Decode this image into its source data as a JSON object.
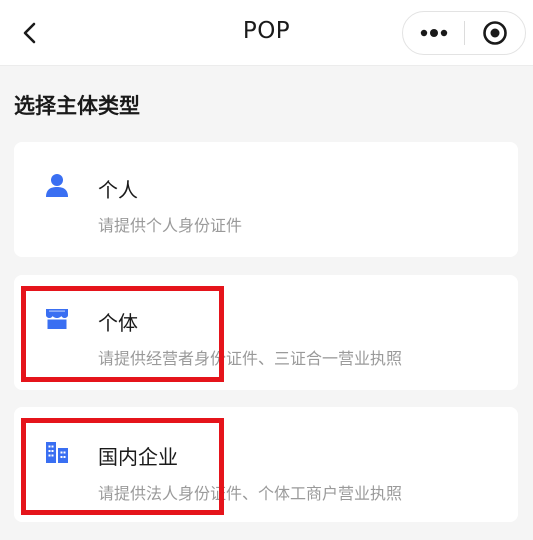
{
  "nav": {
    "title": "POP"
  },
  "section_title": "选择主体类型",
  "options": [
    {
      "title": "个人",
      "subtitle": "请提供个人身份证件",
      "icon": "person-icon"
    },
    {
      "title": "个体",
      "subtitle": "请提供经营者身份证件、三证合一营业执照",
      "icon": "store-icon"
    },
    {
      "title": "国内企业",
      "subtitle": "请提供法人身份证件、个体工商户营业执照",
      "icon": "building-icon"
    }
  ],
  "colors": {
    "accent": "#3a6ff2",
    "highlight": "#e5141b",
    "background": "#f5f5f5"
  }
}
